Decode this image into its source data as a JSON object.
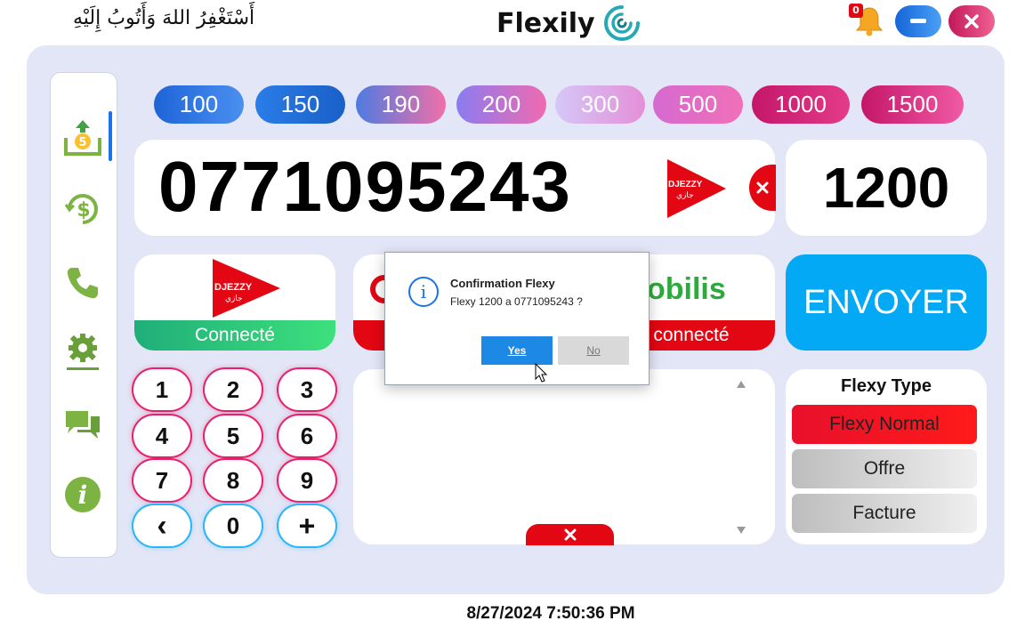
{
  "titlebar": {
    "arabic_text": "أَسْتَغْفِرُ اللهَ وَأَتُوبُ إِلَيْهِ",
    "app_name": "Flexily",
    "notification_count": "0"
  },
  "sidebar": {
    "items": [
      {
        "icon": "upload-money-icon"
      },
      {
        "icon": "dollar-refresh-icon"
      },
      {
        "icon": "phone-icon"
      },
      {
        "icon": "settings-gear-icon"
      },
      {
        "icon": "chat-icon"
      },
      {
        "icon": "info-icon"
      }
    ]
  },
  "amounts": [
    "100",
    "150",
    "190",
    "200",
    "300",
    "500",
    "1000",
    "1500"
  ],
  "phone": {
    "number": "0771095243",
    "operator_logo_text": "DJEZZY",
    "operator_logo_arabic": "جازي"
  },
  "amount_value": "1200",
  "operators": {
    "djezzy": {
      "logo": "DJEZZY",
      "logo_arabic": "جازي",
      "status": "Connecté"
    },
    "ooredoo": {
      "status": ""
    },
    "mobilis": {
      "logo": "obilis",
      "status": "connecté"
    }
  },
  "envoyer_label": "ENVOYER",
  "keypad": [
    "1",
    "2",
    "3",
    "4",
    "5",
    "6",
    "7",
    "8",
    "9",
    "‹",
    "0",
    "+"
  ],
  "flexy_type": {
    "title": "Flexy Type",
    "options": [
      "Flexy Normal",
      "Offre",
      "Facture"
    ]
  },
  "footer": {
    "datetime": "8/27/2024 7:50:36 PM"
  },
  "dialog": {
    "title": "Confirmation Flexy",
    "message": "Flexy 1200 a 0771095243 ?",
    "yes": "Yes",
    "no": "No"
  },
  "colors": {
    "panel": "#e3e6f7",
    "djezzy_red": "#e30613",
    "connected_green": "#2ecc71",
    "envoyer_blue": "#03a9f4",
    "accent_blue": "#1a73e8"
  }
}
